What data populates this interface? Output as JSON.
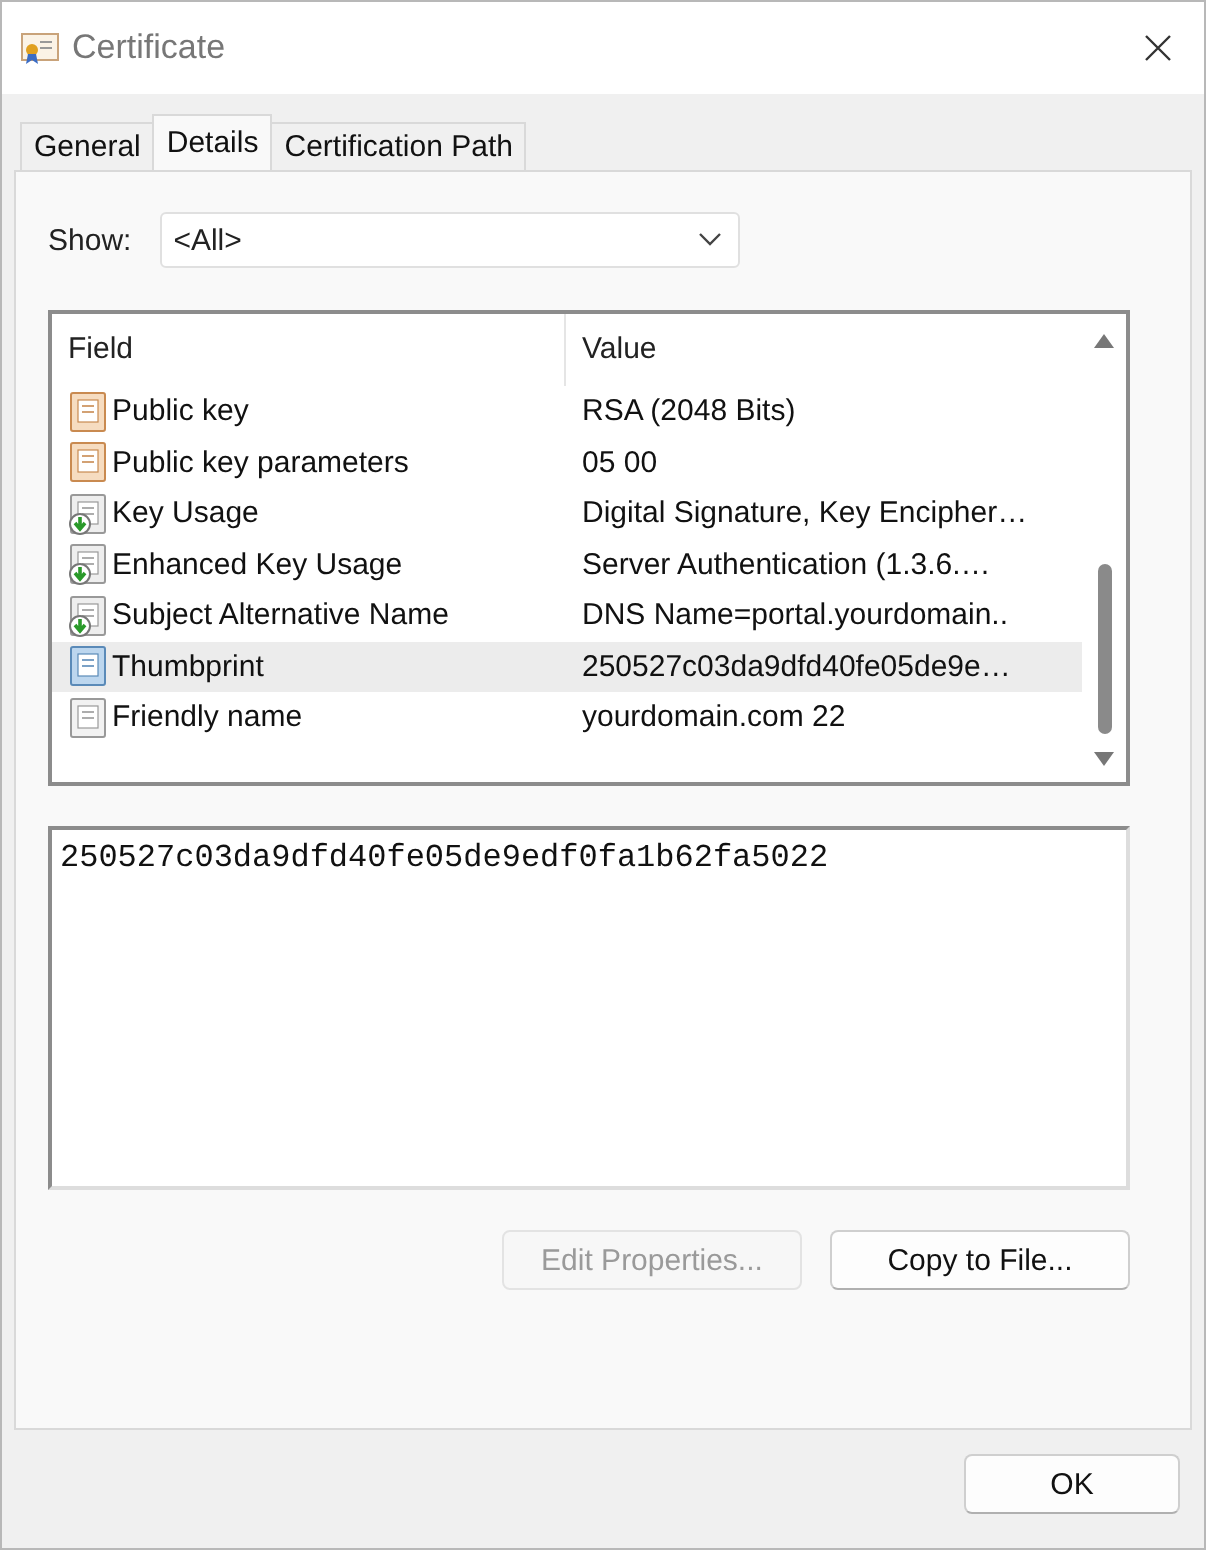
{
  "window": {
    "title": "Certificate"
  },
  "tabs": [
    {
      "label": "General",
      "selected": false
    },
    {
      "label": "Details",
      "selected": true
    },
    {
      "label": "Certification Path",
      "selected": false
    }
  ],
  "show": {
    "label": "Show:",
    "value": "<All>"
  },
  "table": {
    "columns": [
      "Field",
      "Value"
    ],
    "rows": [
      {
        "kind": "field",
        "field": "Public key",
        "value": "RSA (2048 Bits)",
        "selected": false
      },
      {
        "kind": "field",
        "field": "Public key parameters",
        "value": "05 00",
        "selected": false
      },
      {
        "kind": "extension",
        "field": "Key Usage",
        "value": "Digital Signature, Key Encipher…",
        "selected": false
      },
      {
        "kind": "extension",
        "field": "Enhanced Key Usage",
        "value": "Server Authentication (1.3.6.…",
        "selected": false
      },
      {
        "kind": "extension",
        "field": "Subject Alternative Name",
        "value": "DNS Name=portal.yourdomain..",
        "selected": false
      },
      {
        "kind": "thumbprint",
        "field": "Thumbprint",
        "value": "250527c03da9dfd40fe05de9e…",
        "selected": true
      },
      {
        "kind": "property",
        "field": "Friendly name",
        "value": "yourdomain.com 22",
        "selected": false
      }
    ]
  },
  "detail_value": "250527c03da9dfd40fe05de9edf0fa1b62fa5022",
  "buttons": [
    {
      "label": "Edit Properties...",
      "disabled": true
    },
    {
      "label": "Copy to File...",
      "disabled": false
    }
  ],
  "ok_button": "OK"
}
